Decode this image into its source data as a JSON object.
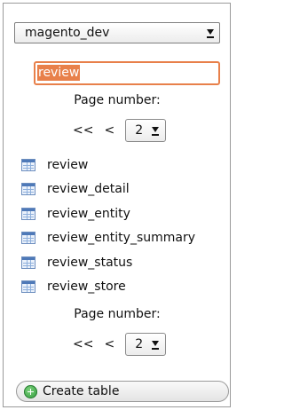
{
  "database": {
    "selected": "magento_dev"
  },
  "filter": {
    "value": "review"
  },
  "pager_top": {
    "label": "Page number:",
    "first": "<<",
    "prev": "<",
    "page": "2"
  },
  "tables": [
    {
      "name": "review"
    },
    {
      "name": "review_detail"
    },
    {
      "name": "review_entity"
    },
    {
      "name": "review_entity_summary"
    },
    {
      "name": "review_status"
    },
    {
      "name": "review_store"
    }
  ],
  "pager_bottom": {
    "label": "Page number:",
    "first": "<<",
    "prev": "<",
    "page": "2"
  },
  "actions": {
    "create_table_label": "Create table"
  },
  "colors": {
    "filter_border": "#e8804a",
    "table_icon": "#4e79b8",
    "create_icon": "#2f9a3c"
  }
}
